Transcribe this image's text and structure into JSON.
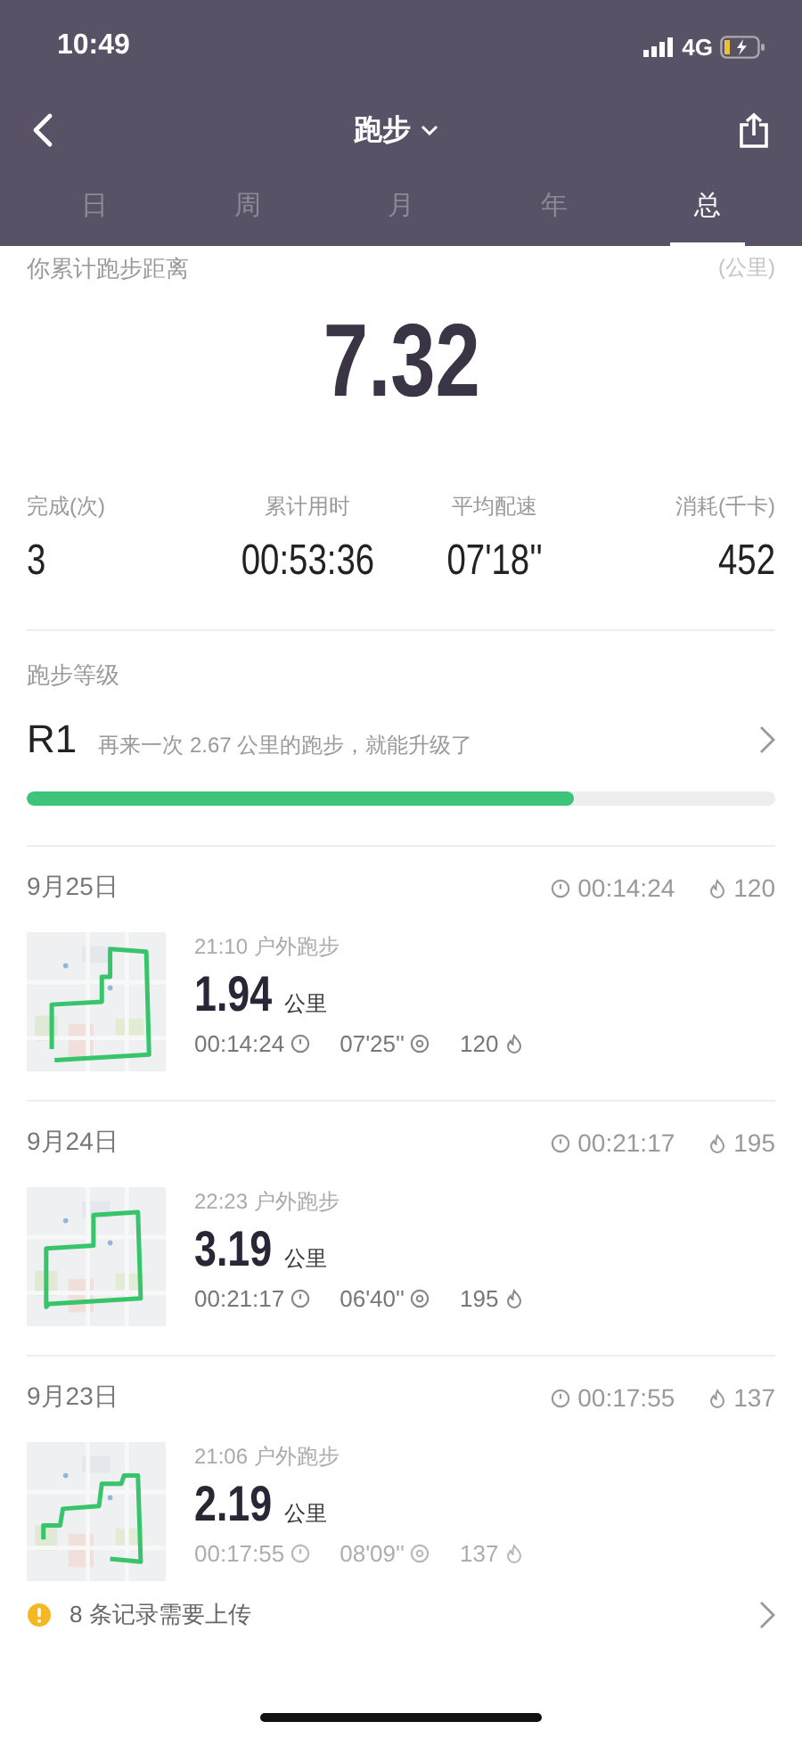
{
  "status_bar": {
    "time": "10:49",
    "network": "4G"
  },
  "nav": {
    "title": "跑步"
  },
  "tabs": [
    {
      "label": "日",
      "selected": false
    },
    {
      "label": "周",
      "selected": false
    },
    {
      "label": "月",
      "selected": false
    },
    {
      "label": "年",
      "selected": false
    },
    {
      "label": "总",
      "selected": true
    }
  ],
  "summary": {
    "label": "你累计跑步距离",
    "unit": "(公里)",
    "total": "7.32",
    "stats": [
      {
        "label": "完成(次)",
        "value": "3"
      },
      {
        "label": "累计用时",
        "value": "00:53:36"
      },
      {
        "label": "平均配速",
        "value": "07'18''"
      },
      {
        "label": "消耗(千卡)",
        "value": "452"
      }
    ]
  },
  "running_level": {
    "title": "跑步等级",
    "grade": "R1",
    "hint": "再来一次 2.67 公里的跑步，就能升级了",
    "level": 0.73
  },
  "days": [
    {
      "date": "9月25日",
      "duration": "00:14:24",
      "calories": "120",
      "records": [
        {
          "time_type": "21:10 户外跑步",
          "distance": "1.94",
          "unit": "公里",
          "duration": "00:14:24",
          "pace": "07'25''",
          "calories": "120",
          "faded": false
        }
      ]
    },
    {
      "date": "9月24日",
      "duration": "00:21:17",
      "calories": "195",
      "records": [
        {
          "time_type": "22:23 户外跑步",
          "distance": "3.19",
          "unit": "公里",
          "duration": "00:21:17",
          "pace": "06'40''",
          "calories": "195",
          "faded": false
        }
      ]
    },
    {
      "date": "9月23日",
      "duration": "00:17:55",
      "calories": "137",
      "records": [
        {
          "time_type": "21:06 户外跑步",
          "distance": "2.19",
          "unit": "公里",
          "duration": "00:17:55",
          "pace": "08'09''",
          "calories": "137",
          "faded": true
        }
      ]
    }
  ],
  "upload_notice": {
    "text": "8 条记录需要上传"
  }
}
